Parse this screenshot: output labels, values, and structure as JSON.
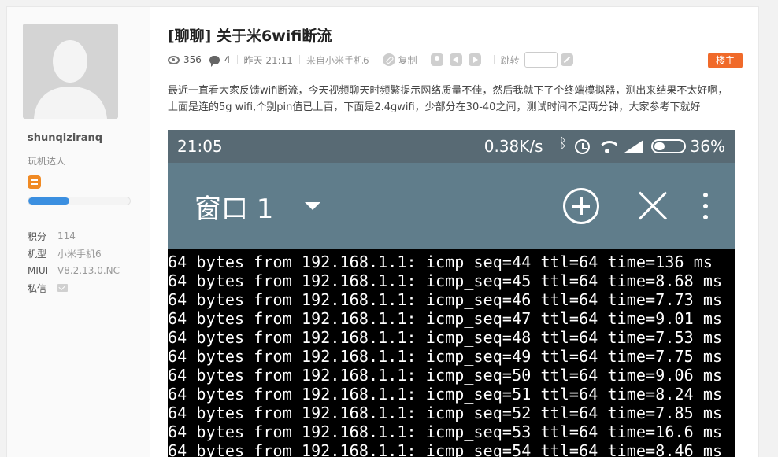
{
  "user": {
    "username": "shunqiziranq",
    "group": "玩机达人",
    "level_progress": 0.4,
    "stats": [
      {
        "key": "积分",
        "value": "114"
      },
      {
        "key": "机型",
        "value": "小米手机6"
      },
      {
        "key": "MIUI",
        "value": "V8.2.13.0.NC"
      },
      {
        "key": "私信",
        "value": ""
      }
    ]
  },
  "post": {
    "title": "[聊聊] 关于米6wifi断流",
    "views": "356",
    "replies": "4",
    "time": "昨天 21:11",
    "source": "来自小米手机6",
    "copy_label": "复制",
    "jump_label": "跳转",
    "op_badge": "楼主",
    "body": "最近一直看大家反馈wifi断流，今天视频聊天时频繁提示网络质量不佳，然后我就下了个终端模拟器，测出来结果不太好啊，上面是连的5g wifi,个别pin值已上百，下面是2.4gwifi，少部分在30-40之间，测试时间不足两分钟，大家参考下就好"
  },
  "screenshot": {
    "clock": "21:05",
    "speed": "0.38K/s",
    "battery": "36%",
    "window_title": "窗口 1",
    "lines": [
      "64 bytes from 192.168.1.1: icmp_seq=44 ttl=64 time=136 ms",
      "64 bytes from 192.168.1.1: icmp_seq=45 ttl=64 time=8.68 ms",
      "64 bytes from 192.168.1.1: icmp_seq=46 ttl=64 time=7.73 ms",
      "64 bytes from 192.168.1.1: icmp_seq=47 ttl=64 time=9.01 ms",
      "64 bytes from 192.168.1.1: icmp_seq=48 ttl=64 time=7.53 ms",
      "64 bytes from 192.168.1.1: icmp_seq=49 ttl=64 time=7.75 ms",
      "64 bytes from 192.168.1.1: icmp_seq=50 ttl=64 time=9.06 ms",
      "64 bytes from 192.168.1.1: icmp_seq=51 ttl=64 time=8.24 ms",
      "64 bytes from 192.168.1.1: icmp_seq=52 ttl=64 time=7.85 ms",
      "64 bytes from 192.168.1.1: icmp_seq=53 ttl=64 time=16.6 ms",
      "64 bytes from 192.168.1.1: icmp_seq=54 ttl=64 time=8.46 ms"
    ]
  },
  "colors": {
    "accent": "#3b8fe0",
    "op_badge": "#f06a2a",
    "status_bar": "#586a74",
    "toolbar": "#607d8b"
  }
}
